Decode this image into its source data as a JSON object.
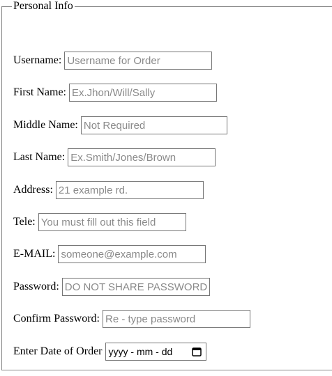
{
  "form": {
    "legend": "Personal Info",
    "fields": [
      {
        "label": "Username:",
        "placeholder": "Username for Order"
      },
      {
        "label": "First Name:",
        "placeholder": "Ex.Jhon/Will/Sally"
      },
      {
        "label": "Middle Name:",
        "placeholder": "Not Required"
      },
      {
        "label": "Last Name:",
        "placeholder": "Ex.Smith/Jones/Brown"
      },
      {
        "label": "Address:",
        "placeholder": "21 example rd."
      },
      {
        "label": "Tele:",
        "placeholder": "You must fill out this field"
      },
      {
        "label": "E-MAIL:",
        "placeholder": "someone@example.com"
      },
      {
        "label": "Password:",
        "placeholder": "DO NOT SHARE PASSWORD"
      },
      {
        "label": "Confirm Password:",
        "placeholder": "Re - type password"
      }
    ],
    "date": {
      "label": "Enter Date of Order",
      "value": "yyyy - mm - dd",
      "icon": "calendar-icon"
    }
  }
}
